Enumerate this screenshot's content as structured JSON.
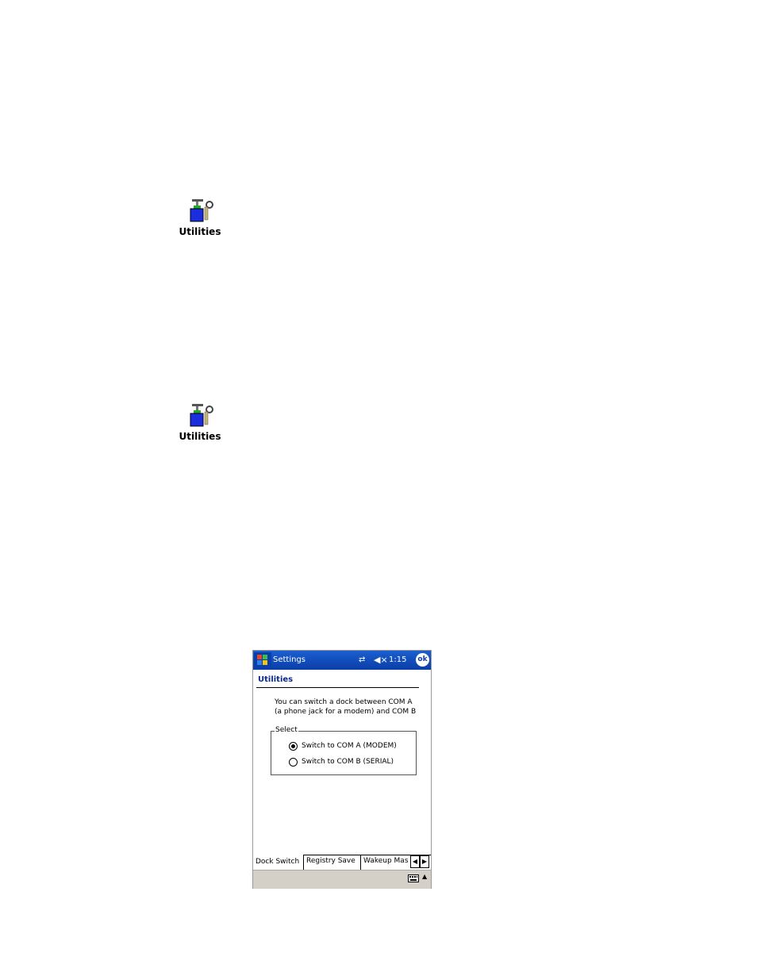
{
  "icons": [
    {
      "label": "Utilities",
      "icon": "utilities-icon"
    },
    {
      "label": "Utilities",
      "icon": "utilities-icon"
    }
  ],
  "device": {
    "titlebar": {
      "app_title": "Settings",
      "time": "1:15",
      "ok_label": "ok",
      "start_icon": "windows-flag-icon",
      "connectivity_icon": "connectivity-icon",
      "volume_icon": "speaker-muted-icon"
    },
    "page_heading": "Utilities",
    "description": [
      "You can switch a dock between COM A",
      "(a phone jack for a modem) and COM B"
    ],
    "select_group": {
      "legend": "Select",
      "options": [
        {
          "label": "Switch to COM A (MODEM)",
          "checked": true
        },
        {
          "label": "Switch to COM B (SERIAL)",
          "checked": false
        }
      ]
    },
    "tabs": [
      {
        "label": "Dock Switch",
        "active": true
      },
      {
        "label": "Registry Save",
        "active": false
      },
      {
        "label": "Wakeup Mas",
        "active": false
      }
    ],
    "tab_scroll": {
      "left": "◀",
      "right": "▶"
    },
    "menubar": {
      "keyboard_icon": "keyboard-icon",
      "sip_arrow": "▲"
    }
  },
  "colors": {
    "titlebar": "#0a3ea8",
    "heading": "#0a2a8a",
    "menubar": "#d4d0c8"
  }
}
